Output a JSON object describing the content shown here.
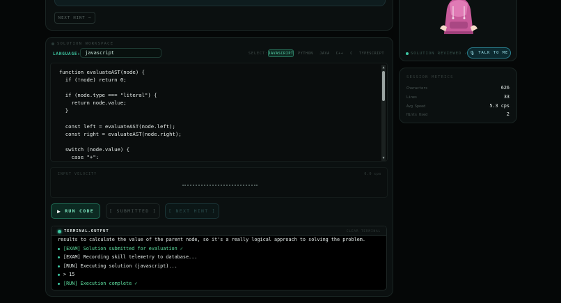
{
  "hint_panel": {
    "next_hint_label": "NEXT HINT →"
  },
  "workspace": {
    "section_title": "SOLUTION WORKSPACE",
    "language_label": "LANGUAGE:",
    "language_value": "javascript",
    "select_label": "SELECT:",
    "languages": [
      {
        "label": "JAVASCRIPT",
        "active": true
      },
      {
        "label": "PYTHON",
        "active": false
      },
      {
        "label": "JAVA",
        "active": false
      },
      {
        "label": "C++",
        "active": false
      },
      {
        "label": "C",
        "active": false
      },
      {
        "label": "TYPESCRIPT",
        "active": false
      }
    ],
    "code_lines": [
      "function evaluateAST(node) {",
      "  if (!node) return 0;",
      "",
      "  if (node.type === \"literal\") {",
      "    return node.value;",
      "  }",
      "",
      "  const left = evaluateAST(node.left);",
      "  const right = evaluateAST(node.right);",
      "",
      "  switch (node.value) {",
      "    case \"+\":"
    ],
    "velocity_label": "INPUT VELOCITY",
    "velocity_value": "0.0 cps",
    "run_label": "RUN CODE",
    "submitted_label": "[ SUBMITTED ]",
    "next_hint_label": "[ NEXT HINT ]"
  },
  "terminal": {
    "title": "TERMINAL.OUTPUT",
    "clear_label": "CLEAR TERMINAL",
    "lines": [
      {
        "text": "results to calculate the value of the parent node, so it's a really logical approach to solving the problem.",
        "bullet": false,
        "success": false
      },
      {
        "text": "[EXAM] Solution submitted for evaluation ✓",
        "bullet": true,
        "success": true
      },
      {
        "text": "[EXAM] Recording skill telemetry to database...",
        "bullet": true,
        "success": false
      },
      {
        "text": "[RUN] Executing solution (javascript)...",
        "bullet": true,
        "success": false
      },
      {
        "text": "> 15",
        "bullet": true,
        "success": false
      },
      {
        "text": "[RUN] Execution complete ✓",
        "bullet": true,
        "success": true
      }
    ]
  },
  "reviewer": {
    "reviewed_label": "SOLUTION REVIEWED ✓",
    "talk_label": "TALK TO ME"
  },
  "metrics": {
    "title": "SESSION METRICS",
    "rows": [
      {
        "label": "Characters",
        "value": "626"
      },
      {
        "label": "Lines",
        "value": "33"
      },
      {
        "label": "Avg Speed",
        "value": "5.3 cps"
      },
      {
        "label": "Hints Used",
        "value": "2"
      }
    ]
  },
  "colors": {
    "accent": "#3ec9a4",
    "success": "#5ee0a0",
    "talk_accent": "#2a7f8f"
  }
}
